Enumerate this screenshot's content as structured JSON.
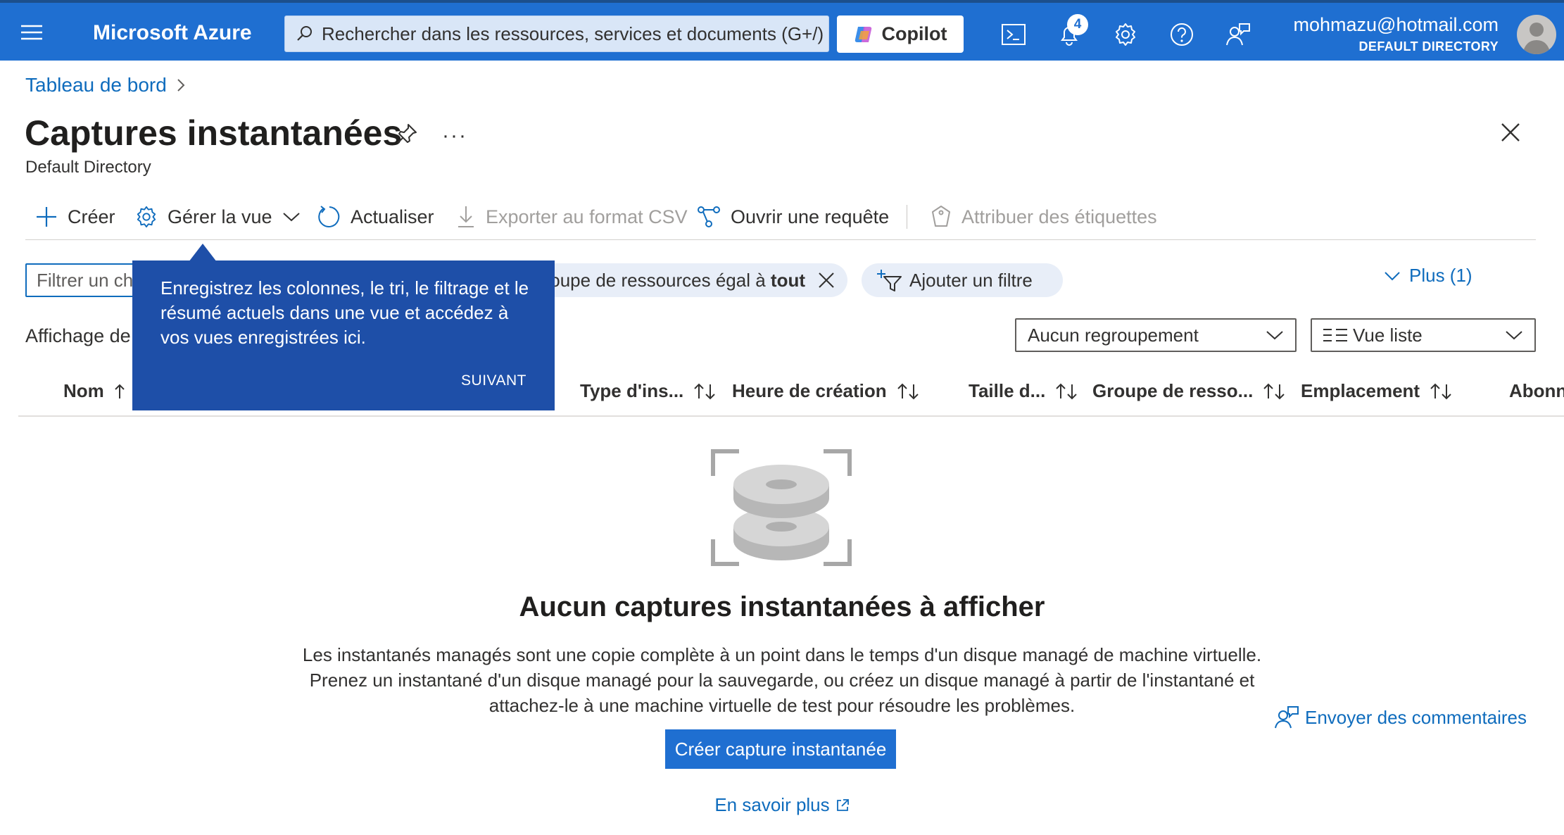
{
  "topbar": {
    "brand": "Microsoft Azure",
    "search_placeholder": "Rechercher dans les ressources, services et documents (G+/)",
    "copilot_label": "Copilot",
    "notification_count": "4",
    "user_email": "mohmazu@hotmail.com",
    "user_directory": "DEFAULT DIRECTORY",
    "icons": [
      "menu-icon",
      "cloud-shell-icon",
      "bell-icon",
      "gear-icon",
      "help-icon",
      "feedback-icon"
    ]
  },
  "breadcrumb": {
    "items": [
      "Tableau de bord"
    ]
  },
  "header": {
    "title": "Captures instantanées",
    "subtitle": "Default Directory",
    "more": "···"
  },
  "toolbar": {
    "create": "Créer",
    "manage_view": "Gérer la vue",
    "refresh": "Actualiser",
    "export_csv": "Exporter au format CSV",
    "open_query": "Ouvrir une requête",
    "assign_tags": "Attribuer des étiquettes"
  },
  "filters": {
    "input_placeholder": "Filtrer un champ...",
    "rg_chip_prefix": "oupe de ressources égal à ",
    "rg_chip_value": "tout",
    "add_filter": "Ajouter un filtre",
    "more_filters": "Plus (1)"
  },
  "view": {
    "affichage_label": "Affichage de",
    "grouping": "Aucun regroupement",
    "view_mode": "Vue liste"
  },
  "columns": [
    "Nom",
    "Type d'ins...",
    "Heure de création",
    "Taille d...",
    "Groupe de resso...",
    "Emplacement",
    "Abonn"
  ],
  "tooltip": {
    "text": "Enregistrez les colonnes, le tri, le filtrage et le résumé actuels dans une vue et accédez à vos vues enregistrées ici.",
    "next": "SUIVANT"
  },
  "empty_state": {
    "title": "Aucun captures instantanées à afficher",
    "desc_line1": "Les instantanés managés sont une copie complète à un point dans le temps d'un disque managé de machine virtuelle.",
    "desc_line2": "Prenez un instantané d'un disque managé pour la sauvegarde, ou créez un disque managé à partir de l'instantané et",
    "desc_line3": "attachez-le à une machine virtuelle de test pour résoudre les problèmes.",
    "create_button": "Créer capture instantanée",
    "learn_more": "En savoir plus"
  },
  "feedback": {
    "label": "Envoyer des commentaires"
  },
  "colors": {
    "topbar": "#1f6fd1",
    "tooltip": "#1e4fa8",
    "link": "#0f6cbd",
    "button": "#1f6fd1"
  }
}
